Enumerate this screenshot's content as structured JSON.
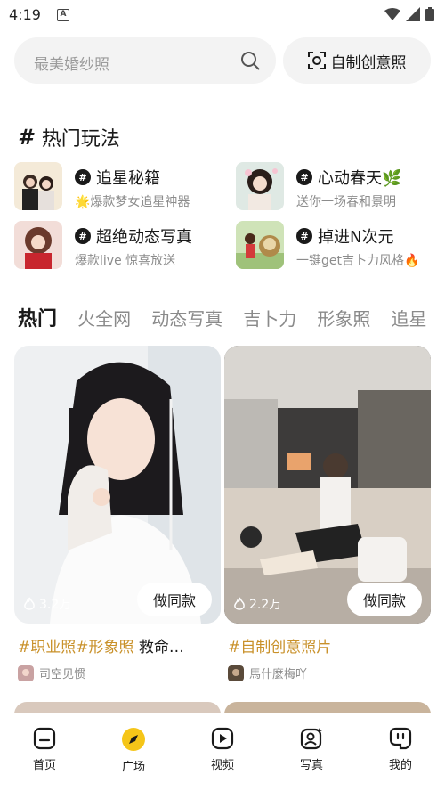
{
  "status_bar": {
    "time": "4:19",
    "notification_icon": "A"
  },
  "search": {
    "placeholder": "最美婚纱照",
    "icon": "search-icon"
  },
  "custom_button": {
    "label": "自制创意照",
    "icon": "camera-frame-icon"
  },
  "section": {
    "hash": "#",
    "title": "热门玩法"
  },
  "play_items": [
    {
      "name": "追星秘籍",
      "desc": "🌟爆款梦女追星神器"
    },
    {
      "name": "心动春天🌿",
      "desc": "送你一场春和景明"
    },
    {
      "name": "超绝动态写真",
      "desc": "爆款live 惊喜放送"
    },
    {
      "name": "掉进N次元",
      "desc": "一键get吉卜力风格🔥"
    }
  ],
  "tabs": [
    "热门",
    "火全网",
    "动态写真",
    "吉卜力",
    "形象照",
    "追星"
  ],
  "cards": [
    {
      "likes": "3.2万",
      "action_label": "做同款",
      "tags": "#职业照#形象照",
      "title_rest": " 救命…",
      "author": "司空见惯"
    },
    {
      "likes": "2.2万",
      "action_label": "做同款",
      "tags": "#自制创意照片",
      "title_rest": "",
      "author": "馬什麼梅吖"
    }
  ],
  "bottom_nav": [
    {
      "label": "首页",
      "icon": "home-icon"
    },
    {
      "label": "广场",
      "icon": "compass-icon"
    },
    {
      "label": "视频",
      "icon": "video-icon"
    },
    {
      "label": "写真",
      "icon": "portrait-icon"
    },
    {
      "label": "我的",
      "icon": "profile-icon"
    }
  ],
  "colors": {
    "accent_yellow": "#f5c518",
    "tag_gold": "#c9912a"
  }
}
